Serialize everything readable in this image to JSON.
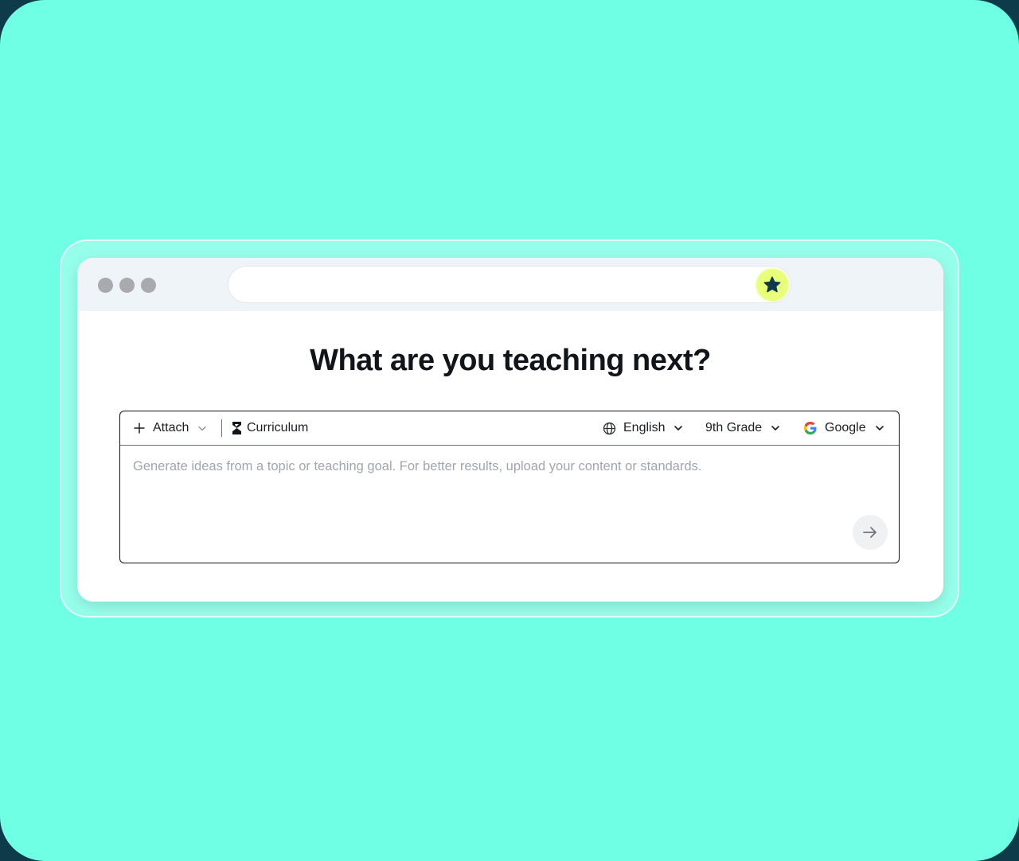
{
  "headline": "What are you teaching next?",
  "toolbar": {
    "attach_label": "Attach",
    "curriculum_label": "Curriculum",
    "language_label": "English",
    "grade_label": "9th Grade",
    "provider_label": "Google"
  },
  "prompt": {
    "placeholder": "Generate ideas from a topic or teaching goal. For better results, upload your content or standards."
  },
  "icons": {
    "window_dots": "traffic-dots-icon",
    "star": "star-icon",
    "attach": "plus-icon",
    "curriculum": "brand-b-icon",
    "language": "globe-icon",
    "provider": "google-g-icon",
    "dropdown": "chevron-down-icon",
    "send": "arrow-right-icon"
  },
  "colors": {
    "page_background": "#6effe4",
    "chrome_background": "#eef4f8",
    "star_button": "#e8ff7a",
    "star_icon": "#0f3a4d",
    "headline_text": "#111418",
    "placeholder_text": "#a1a5ad"
  }
}
